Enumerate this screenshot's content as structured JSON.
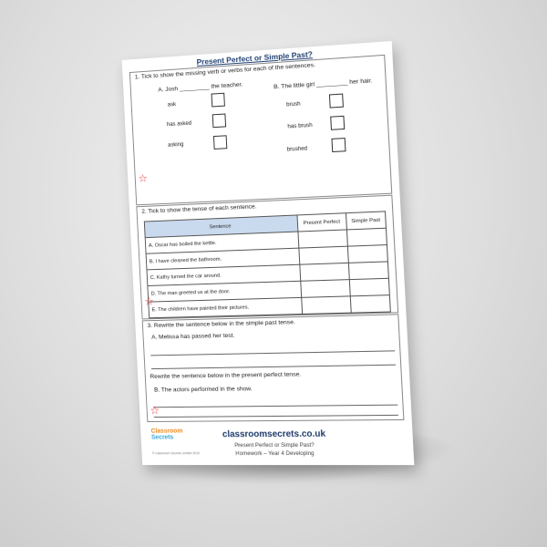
{
  "title": "Present Perfect or Simple Past?",
  "q1": {
    "instruction": "1. Tick to show the missing verb or verbs for each of the sentences.",
    "a": {
      "sentence": "A. Josh _________ the teacher.",
      "options": [
        "ask",
        "has asked",
        "asking"
      ]
    },
    "b": {
      "sentence": "B. The little girl _________ her hair.",
      "options": [
        "brush",
        "has brush",
        "brushed"
      ]
    }
  },
  "q2": {
    "instruction": "2. Tick to show the tense of each sentence.",
    "headers": [
      "Sentence",
      "Present Perfect",
      "Simple Past"
    ],
    "rows": [
      "A. Oscar has boiled the kettle.",
      "B. I have cleaned the bathroom.",
      "C. Kathy turned the car around.",
      "D. The man greeted us at the door.",
      "E. The children have painted their pictures."
    ]
  },
  "q3": {
    "instruction": "3. Rewrite the sentence below in the simple past tense.",
    "a": "A.  Melissa has passed her test.",
    "instruction2": "Rewrite the sentence below in the present perfect tense.",
    "b": "B. The actors performed in the show."
  },
  "footer": {
    "logo_line1": "Classroom",
    "logo_line2": "Secrets",
    "site": "classroomsecrets.co.uk",
    "line1": "Present Perfect or Simple Past?",
    "line2": "Homework – Year 4 Developing",
    "copyright": "© Classroom Secrets Limited 2019"
  }
}
